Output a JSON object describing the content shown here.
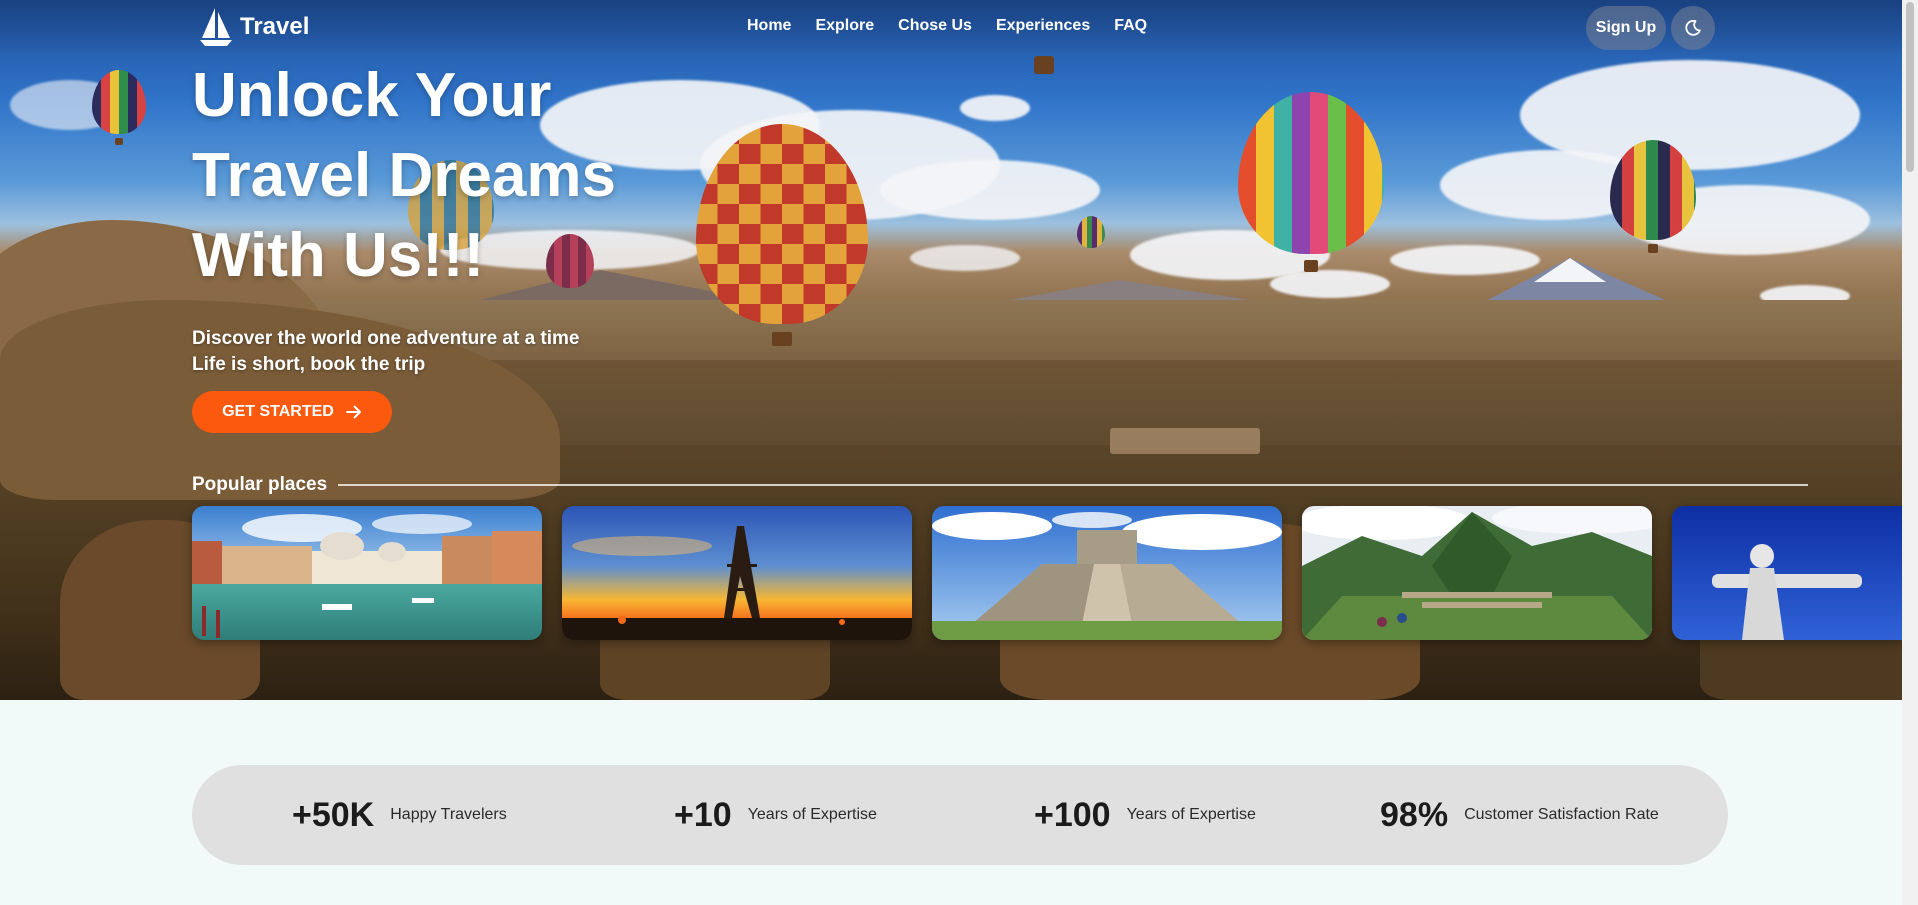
{
  "brand": {
    "name": "Travel",
    "logo_icon": "sailboat-icon"
  },
  "nav": {
    "links": [
      "Home",
      "Explore",
      "Chose Us",
      "Experiences",
      "FAQ"
    ],
    "signup_label": "Sign Up",
    "theme_icon": "moon-icon"
  },
  "hero": {
    "title_lines": [
      "Unlock Your",
      "Travel Dreams",
      "With Us!!!"
    ],
    "subtitle_lines": [
      "Discover the world one adventure at a time",
      "Life is short, book the trip"
    ],
    "cta_label": "GET STARTED",
    "cta_icon": "arrow-right-icon"
  },
  "popular": {
    "title": "Popular places",
    "cards": [
      "venice-canal",
      "eiffel-tower-sunset",
      "chichen-itza-pyramid",
      "machu-picchu",
      "christ-the-redeemer"
    ]
  },
  "stats": [
    {
      "value": "+50K",
      "label": "Happy Travelers"
    },
    {
      "value": "+10",
      "label": "Years of Expertise"
    },
    {
      "value": "+100",
      "label": "Years of Expertise"
    },
    {
      "value": "98%",
      "label": "Customer Satisfaction Rate"
    }
  ],
  "colors": {
    "accent": "#fb5a0e",
    "stats_bg": "#e0e0e0",
    "page_bg": "#f2faf9"
  }
}
